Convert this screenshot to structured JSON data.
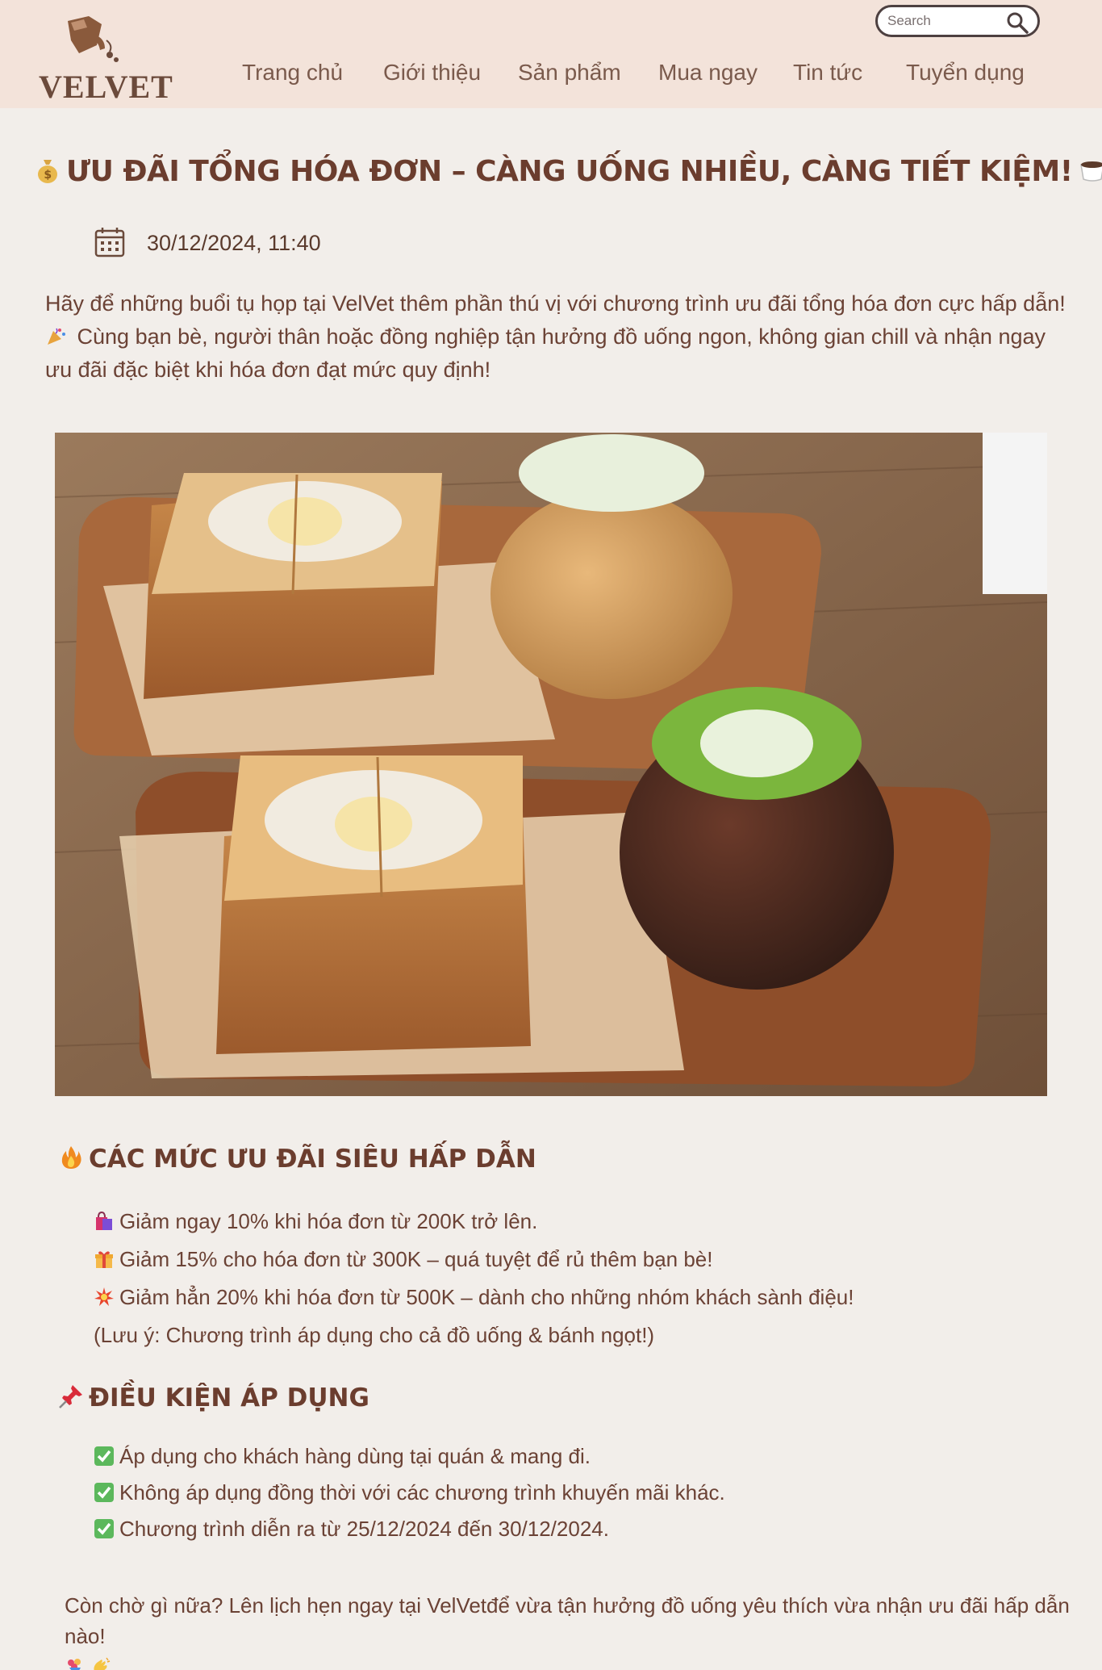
{
  "header": {
    "logo_text": "VELVET",
    "search": {
      "placeholder": "Search"
    },
    "nav": [
      {
        "label": "Trang chủ"
      },
      {
        "label": "Giới thiệu"
      },
      {
        "label": "Sản phẩm"
      },
      {
        "label": "Mua ngay"
      },
      {
        "label": "Tin tức"
      },
      {
        "label": "Tuyển dụng"
      }
    ]
  },
  "article": {
    "title": "ƯU ĐÃI TỔNG HÓA ĐƠN – CÀNG UỐNG NHIỀU, CÀNG TIẾT KIỆM!",
    "title_icon_left": "money-bag-icon",
    "title_icon_right": "coffee-cup-icon",
    "date": "30/12/2024, 11:40",
    "intro_part1": "Hãy để những buổi tụ họp tại VelVet thêm phần thú vị với chương trình ưu đãi tổng hóa đơn cực hấp dẫn!",
    "intro_part2": "Cùng bạn bè, người thân hoặc đồng nghiệp tận hưởng đồ uống ngon, không gian chill và nhận ngay ưu đãi đặc biệt khi hóa đơn đạt mức quy định!",
    "hero_image": "toast-and-matcha-photo",
    "sections": {
      "offers": {
        "heading": "CÁC MỨC ƯU ĐÃI SIÊU HẤP DẪN",
        "icon": "fire-icon",
        "items": [
          {
            "icon": "shopping-bag-icon",
            "text": "Giảm ngay 10% khi hóa đơn từ 200K trở lên."
          },
          {
            "icon": "gift-icon",
            "text": "Giảm 15% cho hóa đơn từ 300K – quá tuyệt để rủ thêm bạn bè!"
          },
          {
            "icon": "burst-icon",
            "text": "Giảm hẳn 20% khi hóa đơn từ 500K – dành cho những nhóm khách sành điệu!"
          }
        ],
        "note": "(Lưu ý: Chương trình áp dụng cho cả đồ uống & bánh ngọt!)"
      },
      "conditions": {
        "heading": "ĐIỀU KIỆN ÁP DỤNG",
        "icon": "pushpin-icon",
        "items": [
          {
            "icon": "check-icon",
            "text": "Áp dụng cho khách hàng dùng tại quán & mang đi."
          },
          {
            "icon": "check-icon",
            "text": "Không áp dụng đồng thời với các chương trình khuyến mãi khác."
          },
          {
            "icon": "check-icon",
            "text": "Chương trình diễn ra từ 25/12/2024 đến 30/12/2024."
          }
        ]
      }
    },
    "closing": "Còn chờ gì nữa? Lên lịch hẹn ngay tại VelVetđể vừa tận hưởng đồ uống yêu thích vừa nhận ưu đãi hấp dẫn nào!"
  },
  "colors": {
    "header_bg": "#f3e3da",
    "page_bg": "#f2eeea",
    "title": "#6b3d2e",
    "body_text": "#6b4235",
    "check_green": "#5cb85c"
  }
}
